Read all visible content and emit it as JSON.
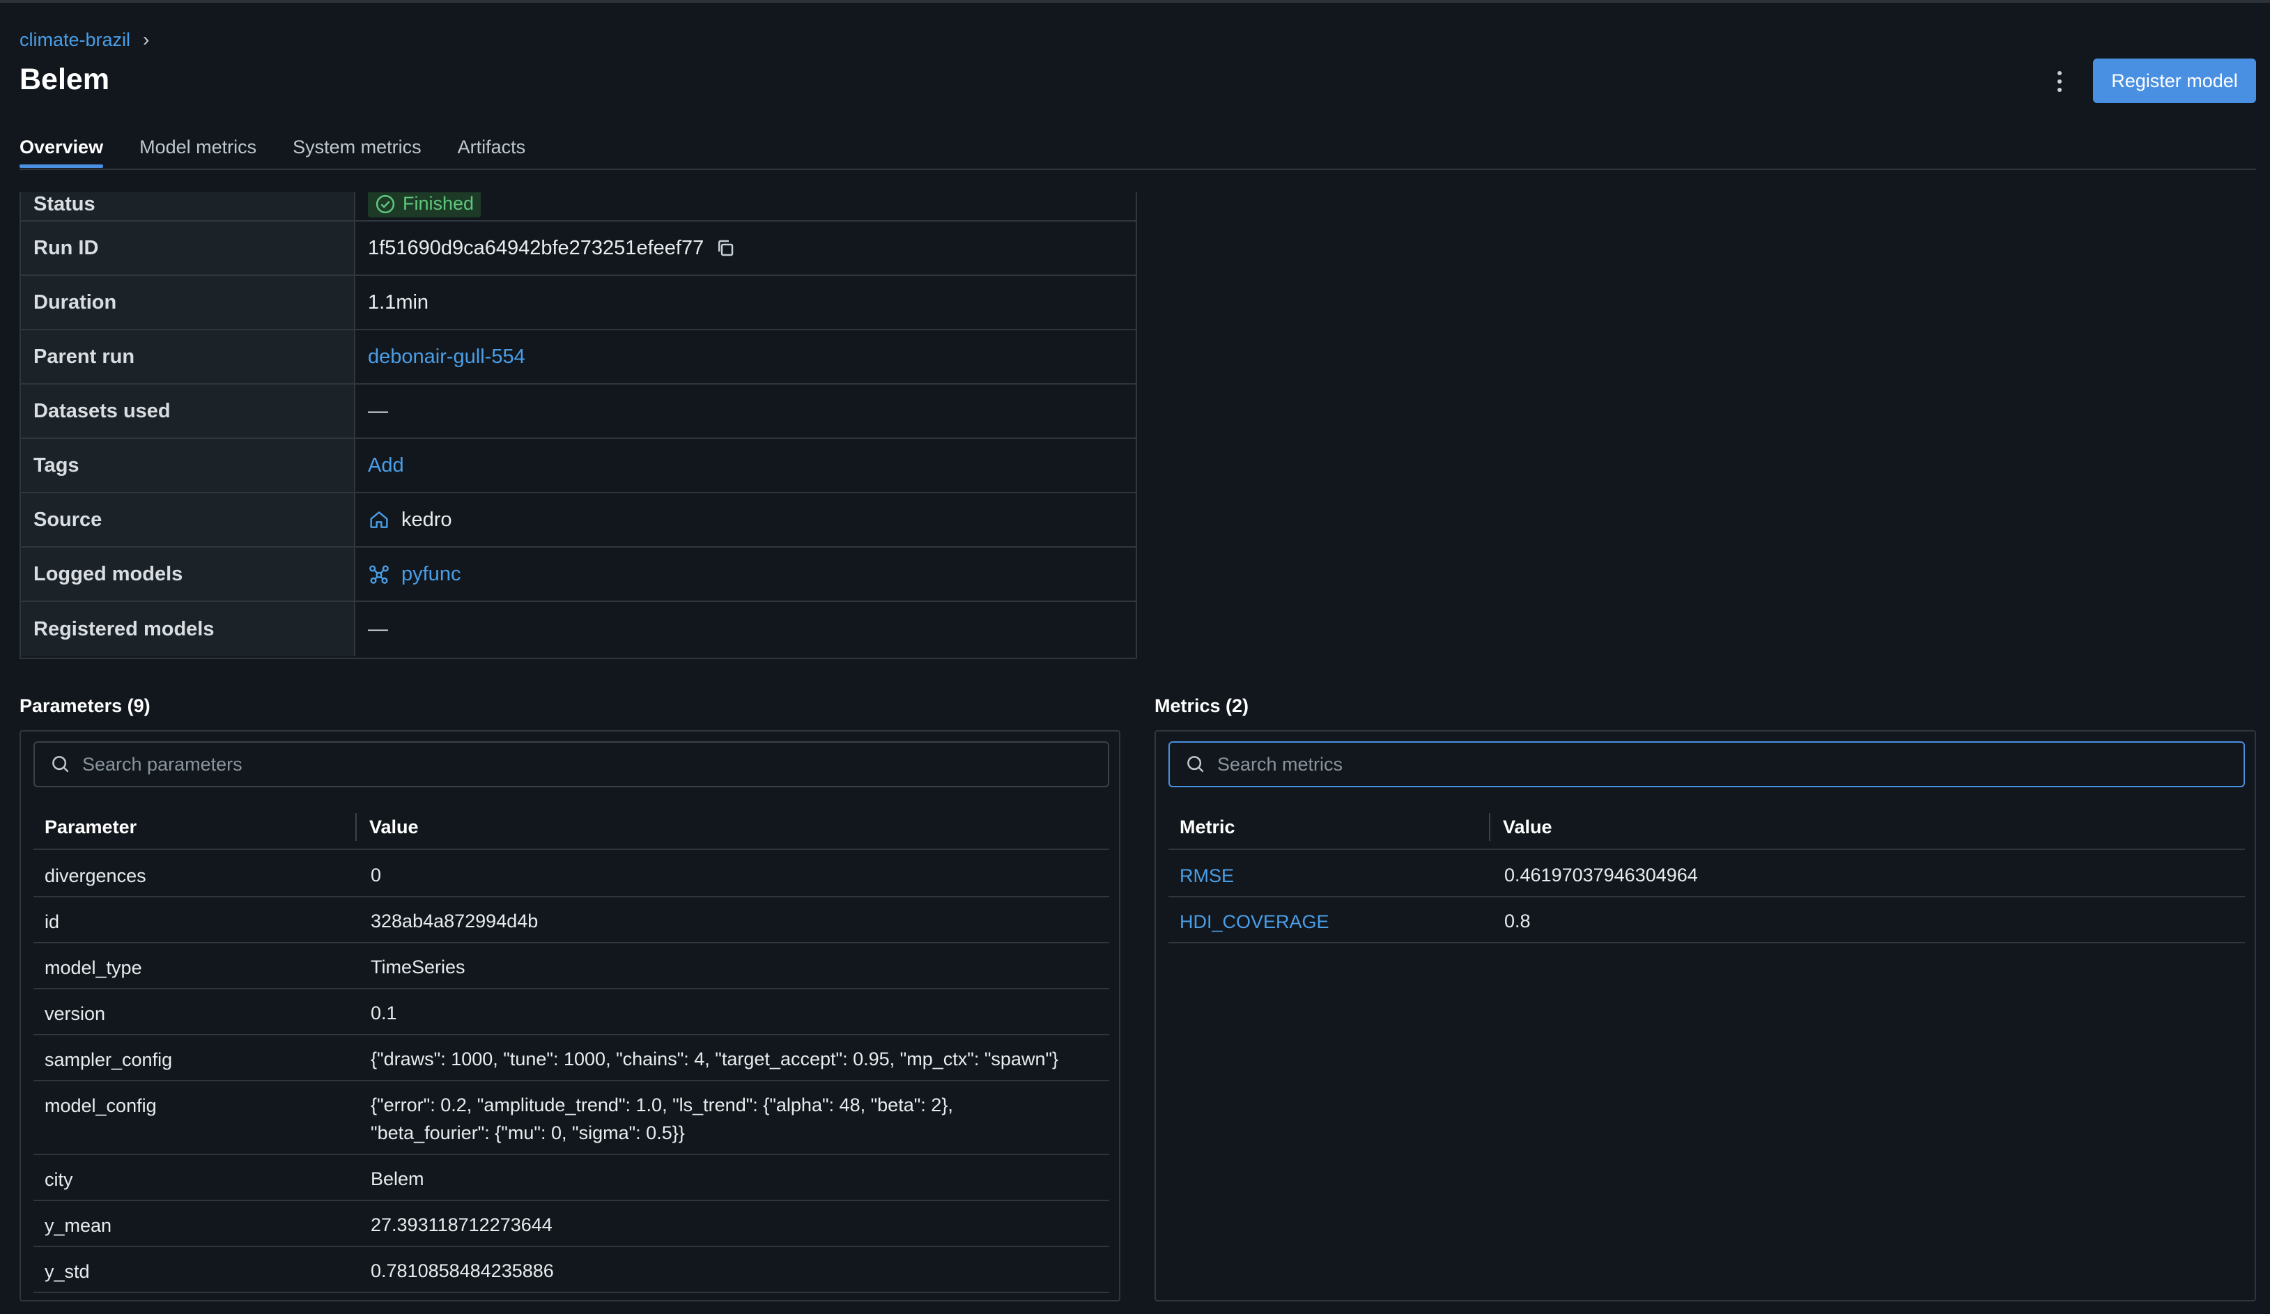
{
  "breadcrumb": {
    "experiment": "climate-brazil",
    "separator": "›"
  },
  "page": {
    "title": "Belem"
  },
  "header": {
    "register_label": "Register model"
  },
  "tabs": [
    {
      "label": "Overview",
      "active": true
    },
    {
      "label": "Model metrics"
    },
    {
      "label": "System metrics"
    },
    {
      "label": "Artifacts"
    }
  ],
  "details": {
    "status": {
      "label": "Status",
      "value": "Finished"
    },
    "run_id": {
      "label": "Run ID",
      "value": "1f51690d9ca64942bfe273251efeef77"
    },
    "duration": {
      "label": "Duration",
      "value": "1.1min"
    },
    "parent_run": {
      "label": "Parent run",
      "value": "debonair-gull-554"
    },
    "datasets": {
      "label": "Datasets used",
      "value": "—"
    },
    "tags": {
      "label": "Tags",
      "value": "Add"
    },
    "source": {
      "label": "Source",
      "value": "kedro"
    },
    "logged_models": {
      "label": "Logged models",
      "value": "pyfunc"
    },
    "registered_models": {
      "label": "Registered models",
      "value": "—"
    }
  },
  "parameters": {
    "title": "Parameters (9)",
    "search_placeholder": "Search parameters",
    "col_name": "Parameter",
    "col_value": "Value",
    "rows": [
      {
        "name": "divergences",
        "value": "0"
      },
      {
        "name": "id",
        "value": "328ab4a872994d4b"
      },
      {
        "name": "model_type",
        "value": "TimeSeries"
      },
      {
        "name": "version",
        "value": "0.1"
      },
      {
        "name": "sampler_config",
        "value": "{\"draws\": 1000, \"tune\": 1000, \"chains\": 4, \"target_accept\": 0.95, \"mp_ctx\": \"spawn\"}"
      },
      {
        "name": "model_config",
        "value": "{\"error\": 0.2, \"amplitude_trend\": 1.0, \"ls_trend\": {\"alpha\": 48, \"beta\": 2}, \"beta_fourier\": {\"mu\": 0, \"sigma\": 0.5}}"
      },
      {
        "name": "city",
        "value": "Belem"
      },
      {
        "name": "y_mean",
        "value": "27.393118712273644"
      },
      {
        "name": "y_std",
        "value": "0.7810858484235886"
      }
    ]
  },
  "metrics": {
    "title": "Metrics (2)",
    "search_placeholder": "Search metrics",
    "col_name": "Metric",
    "col_value": "Value",
    "rows": [
      {
        "name": "RMSE",
        "value": "0.46197037946304964"
      },
      {
        "name": "HDI_COVERAGE",
        "value": "0.8"
      }
    ]
  },
  "colors": {
    "accent": "#4a90e2",
    "link": "#4a9ee8",
    "success": "#5fc77d",
    "background": "#11171c"
  },
  "icons": {
    "status": "check-circle-icon",
    "copy": "copy-icon",
    "source": "home-icon",
    "model": "model-icon",
    "search": "search-icon",
    "menu": "kebab-menu-icon"
  }
}
